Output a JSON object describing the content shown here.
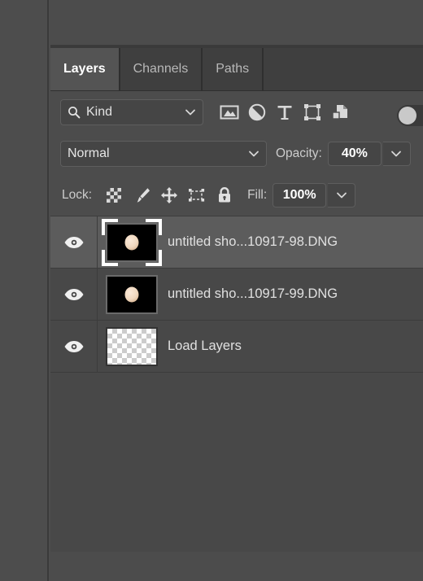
{
  "panel": {
    "tabs": [
      {
        "label": "Layers",
        "active": true
      },
      {
        "label": "Channels",
        "active": false
      },
      {
        "label": "Paths",
        "active": false
      }
    ],
    "filter": {
      "kind_label": "Kind",
      "search_icon": "search-icon",
      "chevron_icon": "chevron-down-icon",
      "type_filters": [
        {
          "name": "filter-pixel-layers",
          "icon": "image-icon"
        },
        {
          "name": "filter-adjustment-layers",
          "icon": "half-circle-icon"
        },
        {
          "name": "filter-type-layers",
          "icon": "type-icon"
        },
        {
          "name": "filter-shape-layers",
          "icon": "shape-icon"
        },
        {
          "name": "filter-smart-objects",
          "icon": "smart-object-icon"
        }
      ],
      "toggle": {
        "name": "filter-enable-toggle",
        "state": "off"
      }
    },
    "blend": {
      "mode": "Normal",
      "opacity_label": "Opacity:",
      "opacity_value": "40%"
    },
    "lock": {
      "label": "Lock:",
      "buttons": [
        {
          "name": "lock-transparent-pixels",
          "icon": "checkerboard-icon"
        },
        {
          "name": "lock-image-pixels",
          "icon": "paintbrush-icon"
        },
        {
          "name": "lock-position",
          "icon": "move-arrows-icon"
        },
        {
          "name": "lock-artboard-nesting",
          "icon": "artboard-icon"
        },
        {
          "name": "lock-all",
          "icon": "padlock-icon"
        }
      ],
      "fill_label": "Fill:",
      "fill_value": "100%"
    },
    "layers": [
      {
        "name": "untitled sho...10917-98.DNG",
        "visible": true,
        "selected": true,
        "thumbnail": "moon-photo"
      },
      {
        "name": "untitled sho...10917-99.DNG",
        "visible": true,
        "selected": false,
        "thumbnail": "moon-photo"
      },
      {
        "name": "Load Layers",
        "visible": true,
        "selected": false,
        "thumbnail": "transparent-checkerboard"
      }
    ]
  },
  "colors": {
    "panel_bg": "#4c4c4c",
    "row_bg": "#484848",
    "row_selected_bg": "#5c5c5c",
    "tab_bg": "#3f3f3f",
    "tab_active_bg": "#545454",
    "text": "#e0e0e0"
  }
}
